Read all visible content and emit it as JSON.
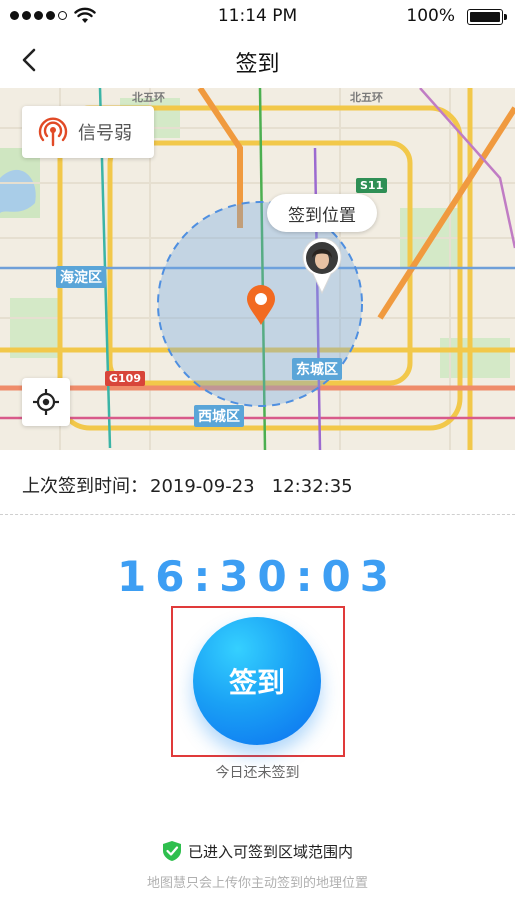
{
  "status_bar": {
    "time": "11:14 PM",
    "battery": "100%"
  },
  "nav": {
    "title": "签到"
  },
  "map": {
    "signal_chip": "信号弱",
    "checkin_location_label": "签到位置",
    "districts": [
      "海淀区",
      "东城区",
      "西城区"
    ],
    "road_badges": [
      "S11",
      "G109"
    ],
    "road_ring_labels": [
      "北五环",
      "北五环"
    ]
  },
  "card": {
    "last_checkin_label": "上次签到时间：",
    "last_checkin_value": "2019-09-23   12:32:35",
    "timer": "16:30:03",
    "checkin_button": "签到",
    "checkin_status": "今日还未签到",
    "zone_status": "已进入可签到区域范围内",
    "privacy_note": "地图慧只会上传你主动签到的地理位置"
  },
  "colors": {
    "accent_blue": "#3d9ef3",
    "highlight_red": "#e03a3a",
    "success_green": "#2fbf4e"
  }
}
